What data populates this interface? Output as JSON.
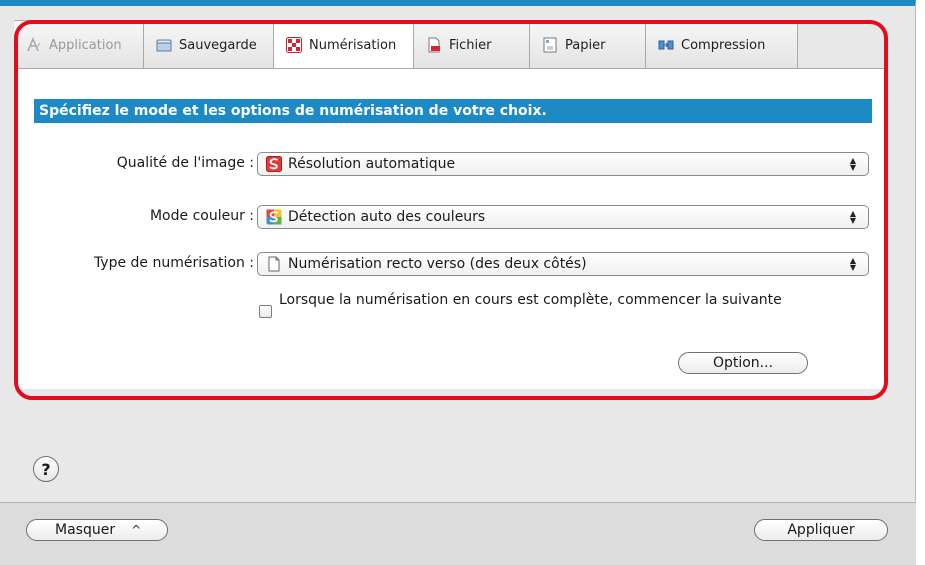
{
  "tabs": [
    {
      "label": "Application",
      "icon": "application-icon",
      "disabled": true
    },
    {
      "label": "Sauvegarde",
      "icon": "folder-icon"
    },
    {
      "label": "Numérisation",
      "icon": "scan-icon",
      "active": true
    },
    {
      "label": "Fichier",
      "icon": "file-icon"
    },
    {
      "label": "Papier",
      "icon": "paper-icon"
    },
    {
      "label": "Compression",
      "icon": "compression-icon"
    }
  ],
  "panel": {
    "banner": "Spécifiez le mode et les options de numérisation de votre choix.",
    "image_quality": {
      "label": "Qualité de l'image :",
      "value": "Résolution automatique"
    },
    "color_mode": {
      "label": "Mode couleur :",
      "value": "Détection auto des couleurs"
    },
    "scan_type": {
      "label": "Type de numérisation :",
      "value": "Numérisation recto verso (des deux côtés)"
    },
    "continue_scan": {
      "label": "Lorsque la numérisation en cours est complète, commencer la suivante",
      "checked": false
    },
    "option_button": "Option..."
  },
  "help_label": "?",
  "footer": {
    "hide_button": "Masquer",
    "hide_arrow": "^",
    "apply_button": "Appliquer"
  },
  "colors": {
    "accent": "#1d8ac6",
    "highlight": "#e30b1c"
  }
}
